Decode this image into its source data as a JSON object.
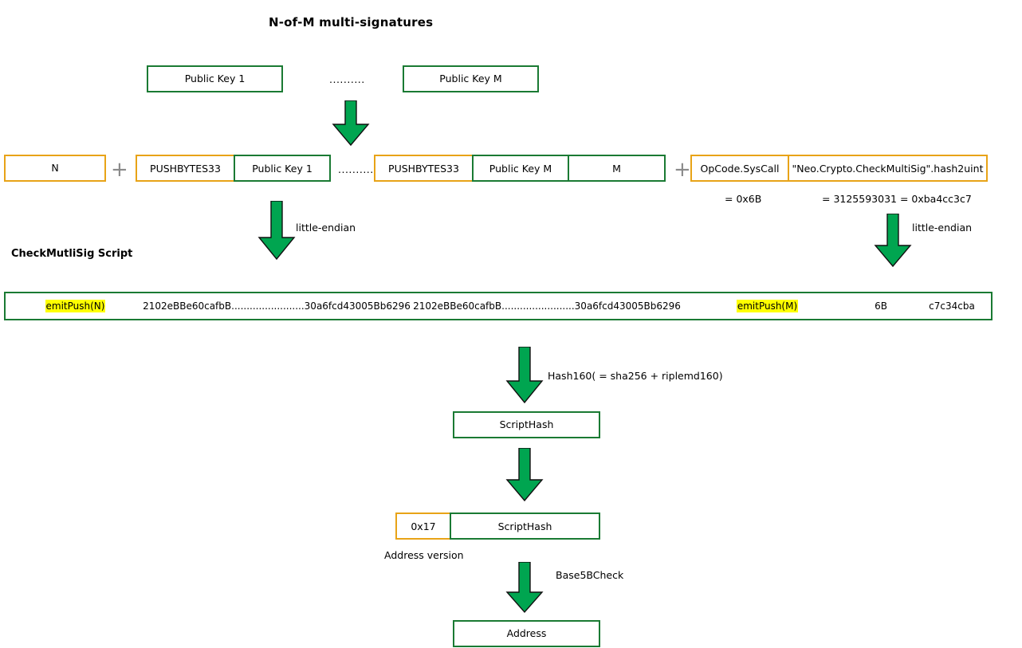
{
  "title": "N-of-M multi-signatures",
  "colors": {
    "arrow_green": "#00a550",
    "box_green": "#1a7a33",
    "box_gold": "#e8a317",
    "highlight": "#ffff00",
    "plus_gray": "#8a8a8a"
  },
  "pubkey_row": {
    "key_first": "Public Key 1",
    "ellipsis": "..........",
    "key_last": "Public Key M"
  },
  "script_row": {
    "n_box": "N",
    "plus": "+",
    "pushbytes_first": "PUSHBYTES33",
    "pubkey_first": "Public Key 1",
    "ellipsis": "..........",
    "pushbytes_last": "PUSHBYTES33",
    "pubkey_last": "Public Key M",
    "m_box": "M",
    "plus2": "+",
    "opcode": "OpCode.SysCall",
    "interop": "\"Neo.Crypto.CheckMultiSig\".hash2uint",
    "opcode_note": "= 0x6B",
    "interop_note": "= 3125593031 = 0xba4cc3c7"
  },
  "annotations": {
    "little_endian_left": "little-endian",
    "little_endian_right": "little-endian",
    "checkmultisig_script": "CheckMutliSig Script",
    "hash160": "Hash160( = sha256 + riplemd160)",
    "address_version": "Address version",
    "base58check": "Base5BCheck"
  },
  "script_bar": {
    "emit_push_n": "emitPush(N)",
    "hex_first": "2102eBBe60cafbB........................30a6fcd43005Bb6296",
    "hex_last": "2102eBBe60cafbB........................30a6fcd43005Bb6296",
    "emit_push_m": "emitPush(M)",
    "syscall_byte": "6B",
    "interop_hash_le": "c7c34cba"
  },
  "hash_flow": {
    "script_hash": "ScriptHash",
    "version_byte": "0x17",
    "script_hash_2": "ScriptHash",
    "address": "Address"
  }
}
